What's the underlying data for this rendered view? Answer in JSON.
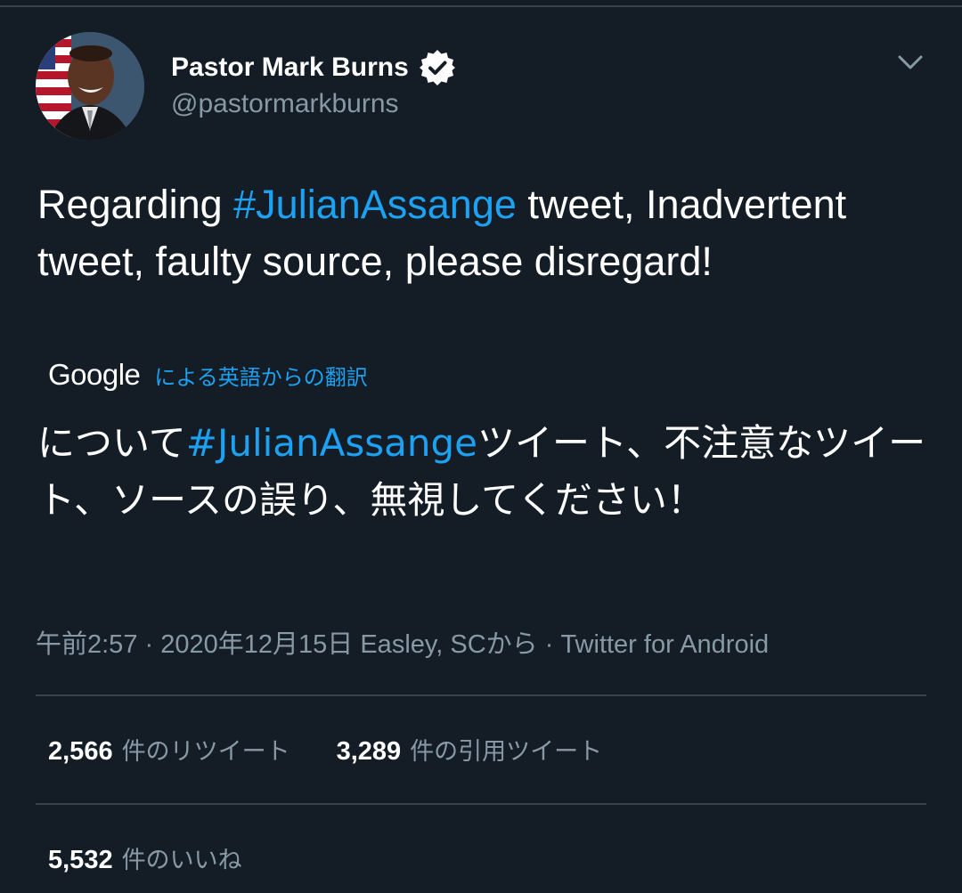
{
  "user": {
    "display_name": "Pastor Mark Burns",
    "handle": "@pastormarkburns",
    "verified": true,
    "avatar": "profile-photo"
  },
  "tweet": {
    "text_before": "Regarding ",
    "hashtag": "#JulianAssange",
    "text_after": " tweet, Inadvertent tweet, faulty source, please disregard!"
  },
  "translation": {
    "provider": "Google",
    "link_label": "による英語からの翻訳",
    "text_before": "について",
    "hashtag": "#JulianAssange",
    "text_after": "ツイート、不注意なツイート、ソースの誤り、無視してください！"
  },
  "meta": {
    "time": "午前2:57",
    "date": "2020年12月15日",
    "location": "Easley, SCから",
    "source": "Twitter for Android",
    "separator": "·"
  },
  "stats": {
    "retweets": {
      "count": "2,566",
      "label": "件のリツイート"
    },
    "quotes": {
      "count": "3,289",
      "label": "件の引用ツイート"
    },
    "likes": {
      "count": "5,532",
      "label": "件のいいね"
    }
  },
  "colors": {
    "background": "#141d26",
    "accent": "#1da1f2",
    "muted": "#8899a6",
    "divider": "#38444d"
  },
  "icons": {
    "verified": "verified-badge-icon",
    "menu": "chevron-down-icon"
  }
}
